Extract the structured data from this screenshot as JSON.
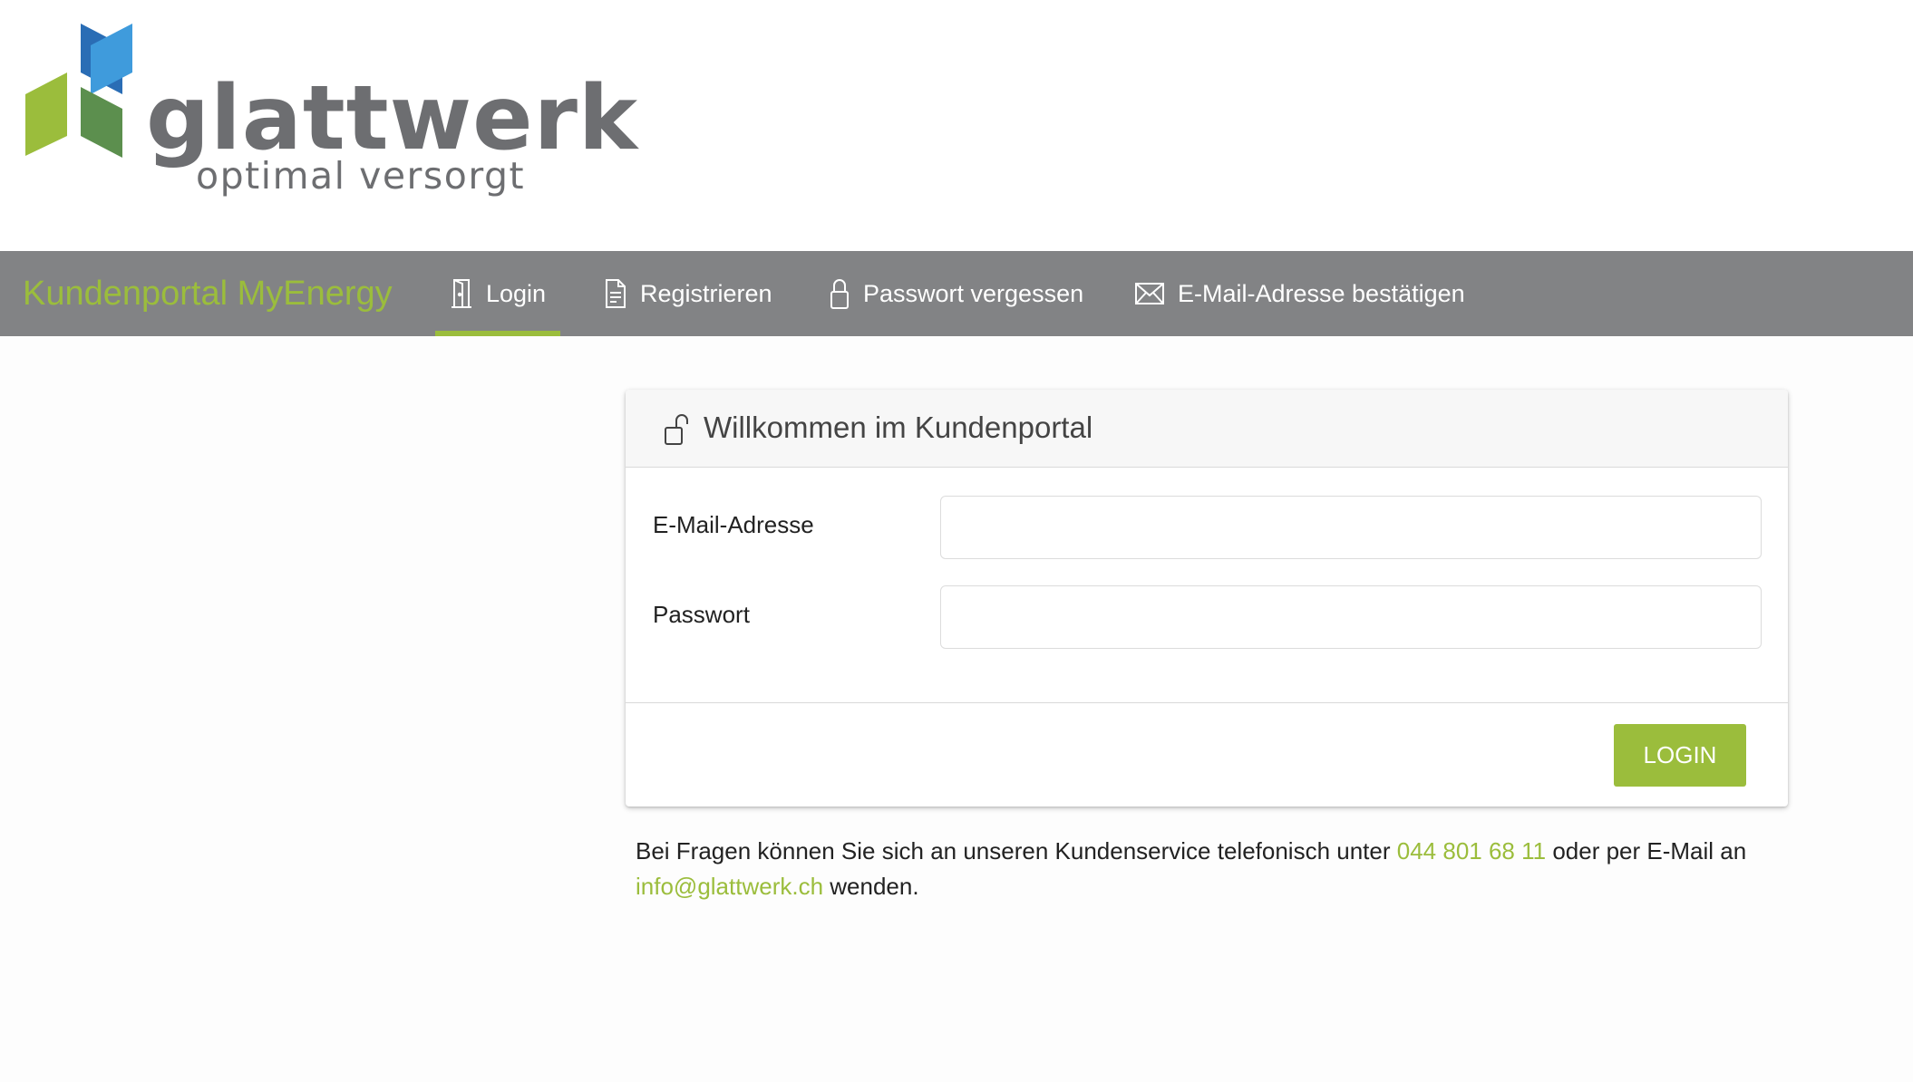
{
  "logo": {
    "word": "glattwerk",
    "tagline": "optimal versorgt"
  },
  "colors": {
    "accent_green": "#9bbd3c",
    "navbar_gray": "#828385",
    "logo_gray": "#6d6e71",
    "logo_blue_dark": "#2a6db5",
    "logo_blue_light": "#3f9bdc",
    "logo_green_light": "#9bbd3c",
    "logo_green_dark": "#5c8f4e"
  },
  "navbar": {
    "brand": "Kundenportal MyEnergy",
    "items": [
      {
        "label": "Login",
        "icon": "door-icon",
        "active": true
      },
      {
        "label": "Registrieren",
        "icon": "document-icon",
        "active": false
      },
      {
        "label": "Passwort vergessen",
        "icon": "lock-icon",
        "active": false
      },
      {
        "label": "E-Mail-Adresse bestätigen",
        "icon": "envelope-icon",
        "active": false
      }
    ]
  },
  "card": {
    "icon": "unlock-icon",
    "title": "Willkommen im Kundenportal",
    "fields": [
      {
        "label": "E-Mail-Adresse",
        "value": "",
        "placeholder": ""
      },
      {
        "label": "Passwort",
        "value": "",
        "placeholder": ""
      }
    ],
    "submit_label": "LOGIN"
  },
  "help": {
    "text_before_phone": "Bei Fragen können Sie sich an unseren Kundenservice telefonisch unter ",
    "phone": "044 801 68 11",
    "text_between": " oder per E-Mail an ",
    "email": "info@glattwerk.ch",
    "text_after": " wenden."
  }
}
